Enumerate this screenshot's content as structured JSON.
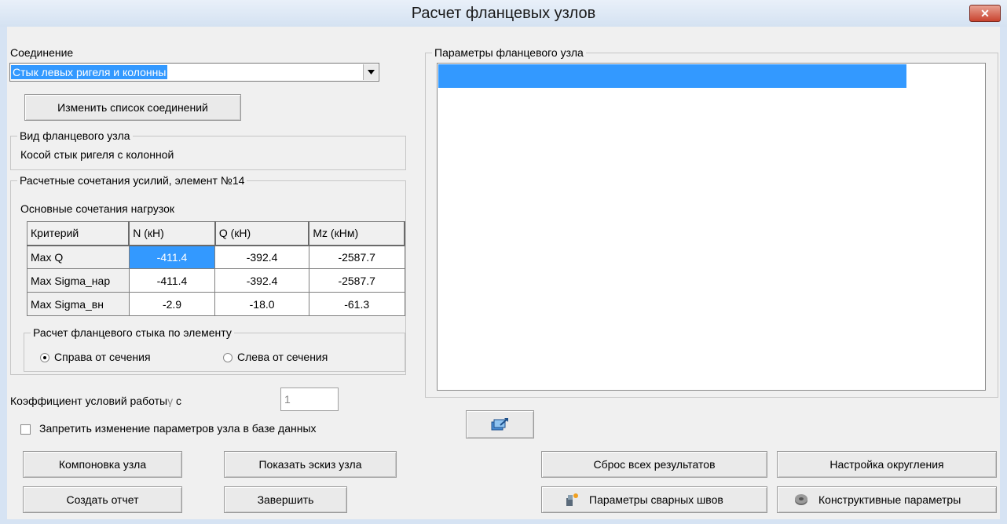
{
  "window": {
    "title": "Расчет фланцевых узлов",
    "close_label": "✕"
  },
  "connection": {
    "label": "Соединение",
    "selected": "Стык левых ригеля и колонны",
    "change_button": "Изменить список соединений"
  },
  "node_type": {
    "legend": "Вид фланцевого узла",
    "value": "Косой стык ригеля с колонной"
  },
  "forces": {
    "legend": "Расчетные сочетания усилий, элемент №14",
    "subtitle": "Основные сочетания нагрузок",
    "columns": [
      "Критерий",
      "N (кН)",
      "Q (кН)",
      "Mz (кНм)"
    ],
    "rows": [
      {
        "name": "Max Q",
        "n": "-411.4",
        "q": "-392.4",
        "mz": "-2587.7"
      },
      {
        "name": "Max Sigma_нар",
        "n": "-411.4",
        "q": "-392.4",
        "mz": "-2587.7"
      },
      {
        "name": "Max Sigma_вн",
        "n": "-2.9",
        "q": "-18.0",
        "mz": "-61.3"
      }
    ],
    "side_group": {
      "legend": "Расчет фланцевого стыка по элементу",
      "right": "Справа от сечения",
      "left": "Слева от сечения"
    }
  },
  "coef": {
    "label": "Коэффициент условий работы",
    "symbol": "γ",
    "sub": "c",
    "value": "1"
  },
  "lock_checkbox": "Запретить изменение параметров узла в базе данных",
  "params": {
    "legend": "Параметры фланцевого узла"
  },
  "buttons": {
    "layout": "Компоновка узла",
    "sketch": "Показать эскиз узла",
    "report": "Создать отчет",
    "finish": "Завершить",
    "reset": "Сброс всех результатов",
    "rounding": "Настройка округления",
    "welds": "Параметры сварных швов",
    "constructive": "Конструктивные параметры"
  },
  "colors": {
    "selection": "#3399ff",
    "title_bg": "#dce7f5",
    "close": "#c9432f"
  }
}
